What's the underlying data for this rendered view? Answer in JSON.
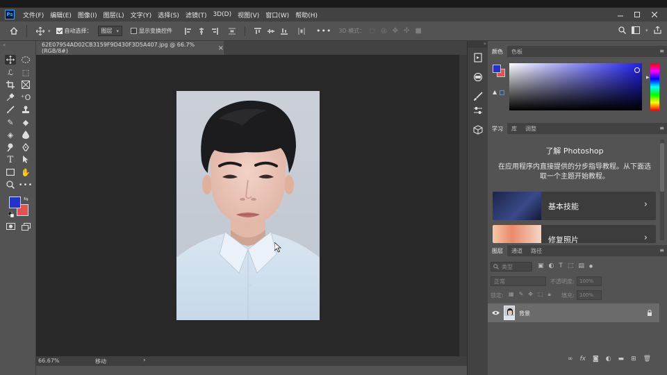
{
  "app": {
    "logo": "Ps"
  },
  "menu": [
    "文件(F)",
    "编辑(E)",
    "图像(I)",
    "图层(L)",
    "文字(Y)",
    "选择(S)",
    "滤镜(T)",
    "3D(D)",
    "视图(V)",
    "窗口(W)",
    "帮助(H)"
  ],
  "options": {
    "auto_select_label": "自动选择：",
    "auto_select_value": "图层",
    "show_transform_label": "显示变换控件",
    "mode_3d_label": "3D 模式："
  },
  "document": {
    "tab_title": "62E07954AD02CB3159F9D430F3D5A407.jpg @ 66.7%(RGB/8#)",
    "close_glyph": "×"
  },
  "status": {
    "zoom": "66.67%",
    "tool": "移动",
    "arrow": "›"
  },
  "colors": {
    "foreground": "#2233cc",
    "background": "#e85050",
    "accent": "#31a8ff"
  },
  "color_panel": {
    "tabs": [
      "颜色",
      "色板"
    ]
  },
  "learn_panel": {
    "tabs": [
      "学习",
      "库",
      "调整"
    ],
    "title": "了解 Photoshop",
    "description": "在应用程序内直接提供的分步指导教程。从下面选取一个主题开始教程。",
    "cards": [
      {
        "label": "基本技能"
      },
      {
        "label": "修复照片"
      }
    ]
  },
  "layers_panel": {
    "tabs": [
      "图层",
      "通道",
      "路径"
    ],
    "filter_placeholder": "类型",
    "blend_mode": "正常",
    "opacity_label": "不透明度:",
    "opacity_value": "100%",
    "lock_label": "锁定:",
    "fill_label": "填充:",
    "fill_value": "100%",
    "layers": [
      {
        "name": "背景",
        "visible": true,
        "locked": true
      }
    ]
  }
}
